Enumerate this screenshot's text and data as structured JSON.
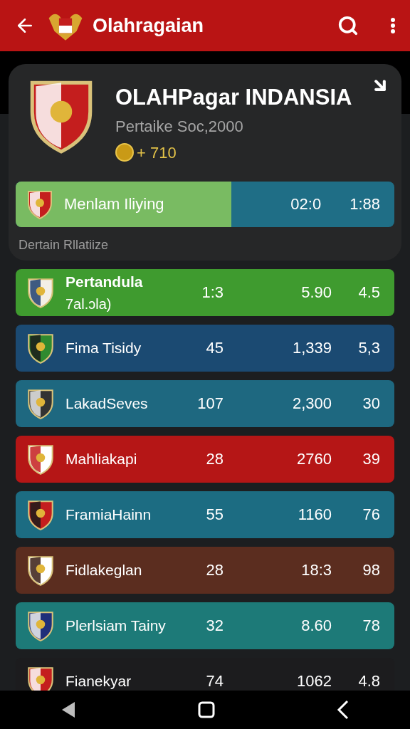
{
  "app_bar": {
    "title": "Olahragaian"
  },
  "team_card": {
    "title": "OLAHPagar INDANSIA",
    "subtitle": "Pertaike Soc,2000",
    "points": "+ 710",
    "highlight": {
      "name": "Menlam Iliying",
      "level": 0.57,
      "value_1": "02:0",
      "value_2": "1:88"
    },
    "footer": "Dertain Rllatiize"
  },
  "rows": [
    {
      "name": "Pertandula",
      "sub": "7al.ɔla)",
      "col_1": "1:3",
      "col_2": "5.90",
      "col_3": "4.5",
      "color": "#3f9b2f"
    },
    {
      "name": "Fima Tisidy",
      "col_1": "45",
      "col_2": "1,339",
      "col_3": "5,3",
      "color": "#1b4a72"
    },
    {
      "name": "LakadSeves",
      "col_1": "107",
      "col_2": "2,300",
      "col_3": "30",
      "color": "#1e6880"
    },
    {
      "name": "Mahliakapi",
      "col_1": "28",
      "col_2": "2760",
      "col_3": "39",
      "color": "#b51616"
    },
    {
      "name": "FramiaHainn",
      "col_1": "55",
      "col_2": "1160",
      "col_3": "76",
      "color": "#1c6c82"
    },
    {
      "name": "Fidlakeglan",
      "col_1": "28",
      "col_2": "18:3",
      "col_3": "98",
      "color": "#5b2d1f"
    },
    {
      "name": "Plerlsiam Tainy",
      "col_1": "32",
      "col_2": "8.60",
      "col_3": "78",
      "color": "#1d7a78"
    },
    {
      "name": "Fianekyar",
      "col_1": "74",
      "col_2": "1062",
      "col_3": "4.8",
      "color": "#1c1c1e"
    }
  ]
}
